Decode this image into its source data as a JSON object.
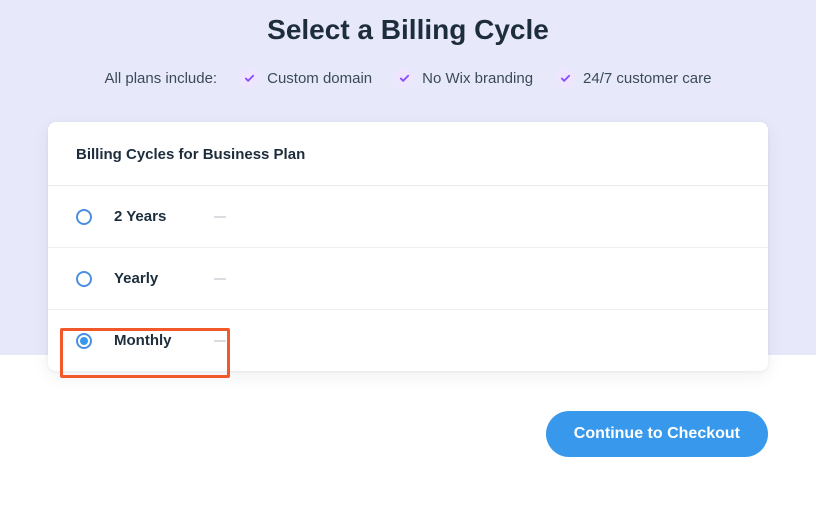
{
  "title": "Select a Billing Cycle",
  "includes_label": "All plans include:",
  "features": {
    "f0": "Custom domain",
    "f1": "No Wix branding",
    "f2": "24/7 customer care"
  },
  "card": {
    "header": "Billing Cycles for Business Plan",
    "options": {
      "o0": {
        "label": "2 Years",
        "selected": false
      },
      "o1": {
        "label": "Yearly",
        "selected": false
      },
      "o2": {
        "label": "Monthly",
        "selected": true
      }
    }
  },
  "cta": "Continue to Checkout"
}
